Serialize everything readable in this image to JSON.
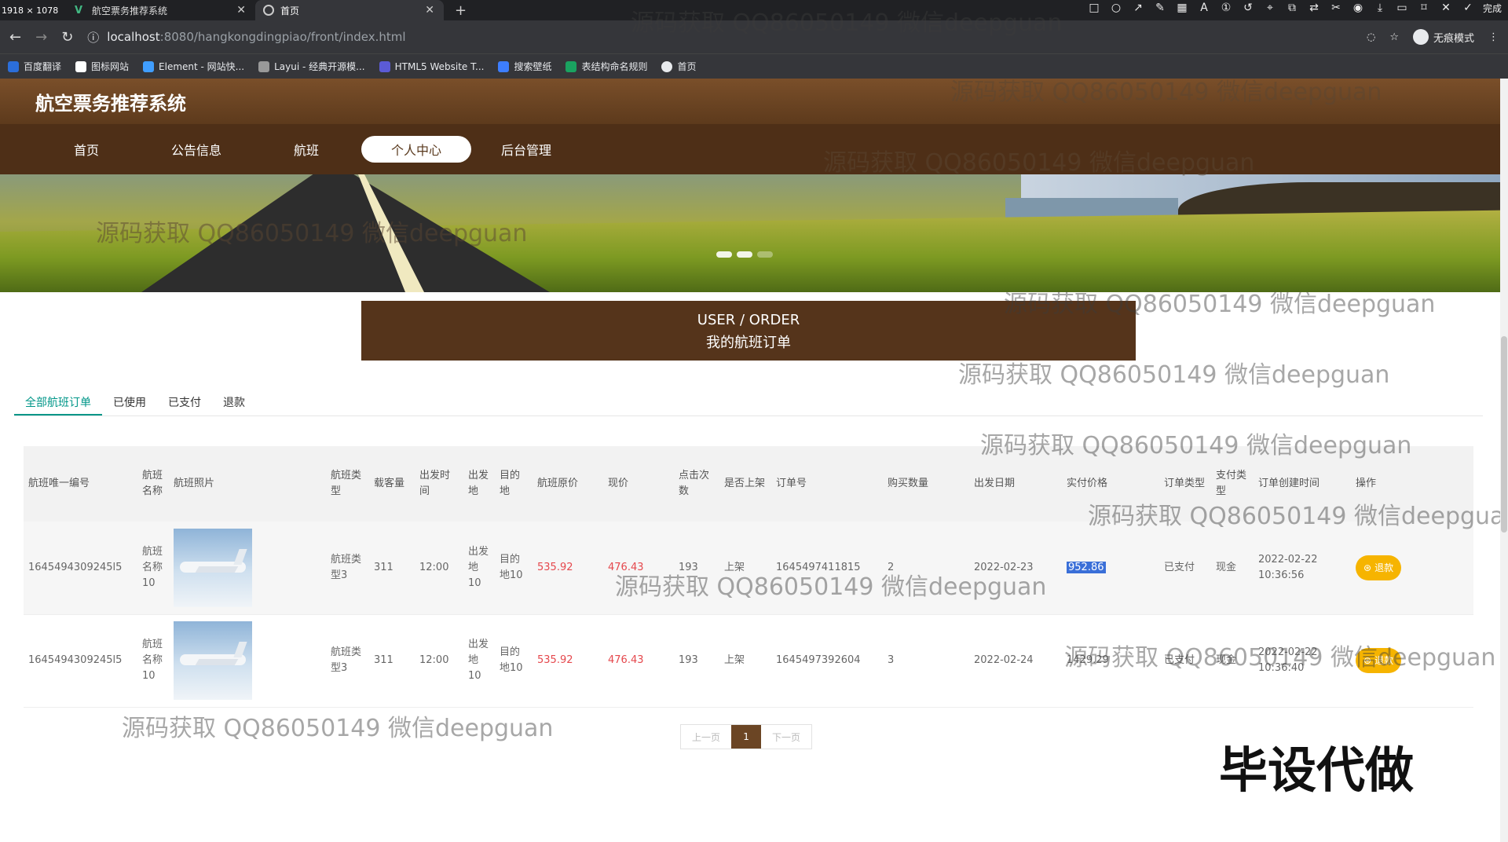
{
  "browser": {
    "window_size": "1918 × 1078",
    "tabs": [
      {
        "title": "航空票务推荐系统"
      },
      {
        "title": "首页"
      }
    ],
    "url_host": "localhost",
    "url_rest": ":8080/hangkongdingpiao/front/index.html",
    "incognito_label": "无痕模式",
    "done_label": "完成",
    "bookmarks": [
      {
        "label": "百度翻译",
        "color": "#2b6ed9"
      },
      {
        "label": "图标网站",
        "color": "#ffffff"
      },
      {
        "label": "Element - 网站快...",
        "color": "#409eff"
      },
      {
        "label": "Layui - 经典开源模...",
        "color": "#999999"
      },
      {
        "label": "HTML5 Website T...",
        "color": "#5b5bd6"
      },
      {
        "label": "搜索壁纸",
        "color": "#3d7eff"
      },
      {
        "label": "表结构命名规则",
        "color": "#1aa260"
      },
      {
        "label": "首页",
        "color": "#e8eaed"
      }
    ]
  },
  "site": {
    "title": "航空票务推荐系统",
    "nav": [
      "首页",
      "公告信息",
      "航班",
      "个人中心",
      "后台管理"
    ],
    "active_nav": "个人中心"
  },
  "section": {
    "en_title": "USER / ORDER",
    "cn_title": "我的航班订单"
  },
  "filter_tabs": [
    "全部航班订单",
    "已使用",
    "已支付",
    "退款"
  ],
  "table": {
    "headers": [
      "航班唯一编号",
      "航班名称",
      "航班照片",
      "航班类型",
      "载客量",
      "出发时间",
      "出发地",
      "目的地",
      "航班原价",
      "现价",
      "点击次数",
      "是否上架",
      "订单号",
      "购买数量",
      "出发日期",
      "实付价格",
      "订单类型",
      "支付类型",
      "订单创建时间",
      "操作"
    ],
    "rows": [
      {
        "id": "1645494309245l5",
        "name": "航班名称10",
        "type": "航班类型3",
        "capacity": "311",
        "time": "12:00",
        "from": "出发地10",
        "to": "目的地10",
        "orig_price": "535.92",
        "price": "476.43",
        "clicks": "193",
        "listed": "上架",
        "order_no": "1645497411815",
        "qty": "2",
        "date": "2022-02-23",
        "paid": "952.86",
        "order_type": "已支付",
        "pay_type": "现金",
        "created": "2022-02-22 10:36:56",
        "action": "退款"
      },
      {
        "id": "1645494309245l5",
        "name": "航班名称10",
        "type": "航班类型3",
        "capacity": "311",
        "time": "12:00",
        "from": "出发地10",
        "to": "目的地10",
        "orig_price": "535.92",
        "price": "476.43",
        "clicks": "193",
        "listed": "上架",
        "order_no": "1645497392604",
        "qty": "3",
        "date": "2022-02-24",
        "paid": "1429.29",
        "order_type": "已支付",
        "pay_type": "现金",
        "created": "2022-02-22 10:36:40",
        "action": "退款"
      }
    ]
  },
  "pager": {
    "prev": "上一页",
    "current": "1",
    "next": "下一页"
  },
  "watermark": "源码获取 QQ86050149 微信deepguan",
  "ad_text": "毕设代做",
  "colors": {
    "brand_brown": "#55341b",
    "nav_brown": "#4e2f17",
    "accent_teal": "#009688",
    "price_red": "#e5484d",
    "refund_yellow": "#f6b400"
  }
}
